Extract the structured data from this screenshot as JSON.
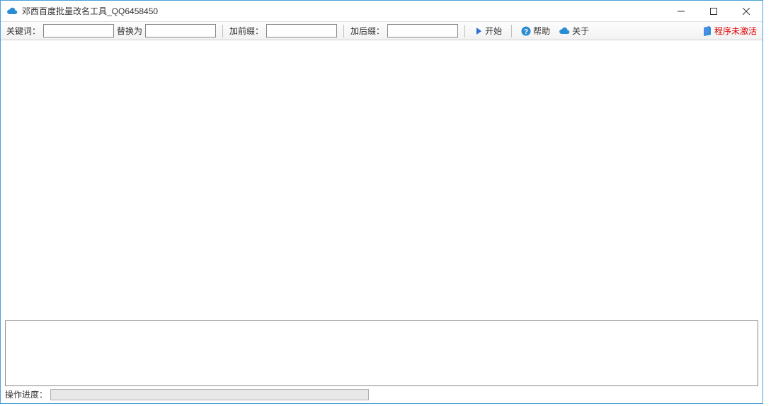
{
  "titlebar": {
    "title": "邓西百度批量改名工具_QQ6458450"
  },
  "toolbar": {
    "keyword_label": "关键词：",
    "replace_label": "替换为",
    "prefix_label": "加前缀：",
    "suffix_label": "加后缀：",
    "start_label": "开始",
    "help_label": "帮助",
    "about_label": "关于",
    "keyword_value": "",
    "replace_value": "",
    "prefix_value": "",
    "suffix_value": ""
  },
  "status": {
    "activation": "程序未激活"
  },
  "bottom": {
    "progress_label": "操作进度："
  }
}
